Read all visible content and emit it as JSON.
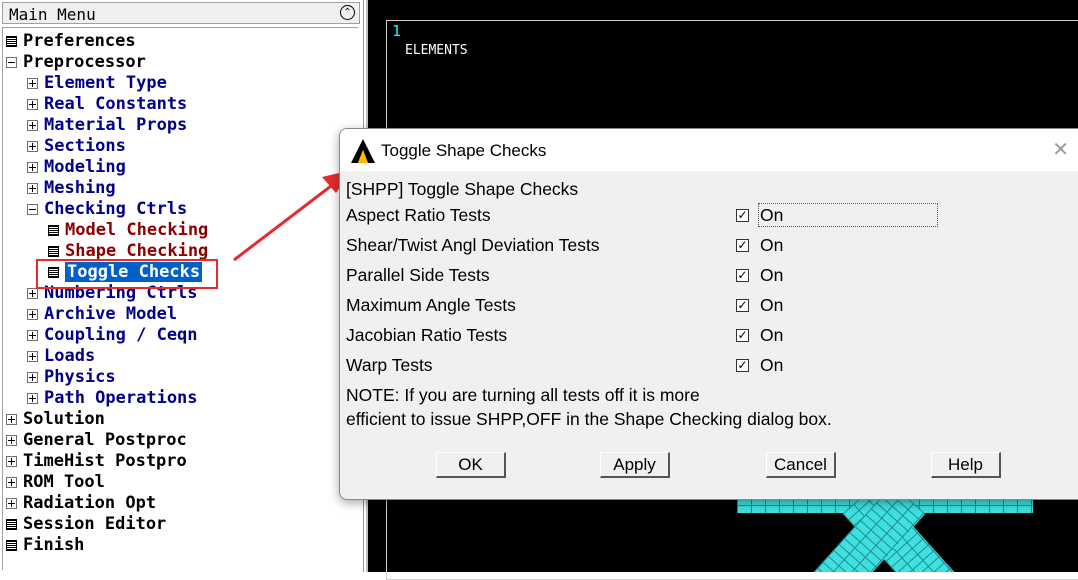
{
  "main_menu": {
    "title": "Main Menu",
    "collapse_icon": "double-chevron-up-icon",
    "items": [
      {
        "label": "Preferences",
        "icon": "command-icon"
      },
      {
        "label": "Preprocessor",
        "icon": "tree-minus-icon"
      },
      {
        "label": "Element Type",
        "icon": "tree-plus-icon"
      },
      {
        "label": "Real Constants",
        "icon": "tree-plus-icon"
      },
      {
        "label": "Material Props",
        "icon": "tree-plus-icon"
      },
      {
        "label": "Sections",
        "icon": "tree-plus-icon"
      },
      {
        "label": "Modeling",
        "icon": "tree-plus-icon"
      },
      {
        "label": "Meshing",
        "icon": "tree-plus-icon"
      },
      {
        "label": "Checking Ctrls",
        "icon": "tree-minus-icon"
      },
      {
        "label": "Model Checking",
        "icon": "command-icon"
      },
      {
        "label": "Shape Checking",
        "icon": "command-icon"
      },
      {
        "label": "Toggle Checks",
        "icon": "command-icon",
        "selected": true
      },
      {
        "label": "Numbering Ctrls",
        "icon": "tree-plus-icon"
      },
      {
        "label": "Archive Model",
        "icon": "tree-plus-icon"
      },
      {
        "label": "Coupling / Ceqn",
        "icon": "tree-plus-icon"
      },
      {
        "label": "Loads",
        "icon": "tree-plus-icon"
      },
      {
        "label": "Physics",
        "icon": "tree-plus-icon"
      },
      {
        "label": "Path Operations",
        "icon": "tree-plus-icon"
      },
      {
        "label": "Solution",
        "icon": "tree-plus-icon"
      },
      {
        "label": "General Postproc",
        "icon": "tree-plus-icon"
      },
      {
        "label": "TimeHist Postpro",
        "icon": "tree-plus-icon"
      },
      {
        "label": "ROM Tool",
        "icon": "tree-plus-icon"
      },
      {
        "label": "Radiation Opt",
        "icon": "tree-plus-icon"
      },
      {
        "label": "Session Editor",
        "icon": "command-icon"
      },
      {
        "label": "Finish",
        "icon": "command-icon"
      }
    ]
  },
  "graphics": {
    "window_number": "1",
    "plot_label": "ELEMENTS",
    "mesh_color": "#40e0e0",
    "background": "#000000"
  },
  "annotation": {
    "color": "#e52b2b"
  },
  "dialog": {
    "title": "Toggle Shape Checks",
    "close_icon": "close-icon",
    "logo_icon": "ansys-logo-icon",
    "command": "[SHPP] Toggle Shape Checks",
    "checks": [
      {
        "label": "Aspect Ratio Tests",
        "checked": true,
        "state": "On"
      },
      {
        "label": "Shear/Twist Angl Deviation Tests",
        "checked": true,
        "state": "On"
      },
      {
        "label": "Parallel Side Tests",
        "checked": true,
        "state": "On"
      },
      {
        "label": "Maximum Angle Tests",
        "checked": true,
        "state": "On"
      },
      {
        "label": "Jacobian Ratio Tests",
        "checked": true,
        "state": "On"
      },
      {
        "label": "Warp Tests",
        "checked": true,
        "state": "On"
      }
    ],
    "note_line1": "NOTE: If you are turning all tests off it is more",
    "note_line2": "efficient to issue SHPP,OFF in the Shape Checking dialog box.",
    "buttons": {
      "ok": "OK",
      "apply": "Apply",
      "cancel": "Cancel",
      "help": "Help"
    }
  }
}
